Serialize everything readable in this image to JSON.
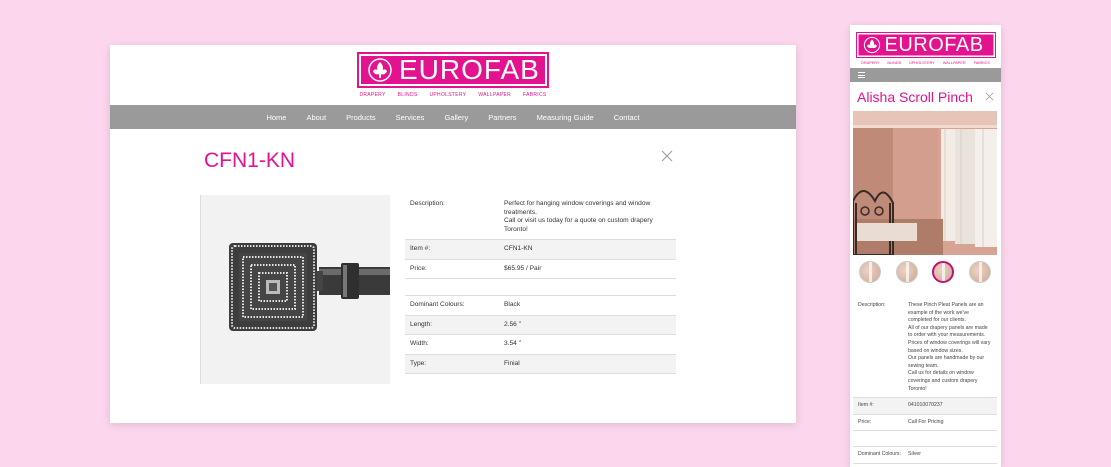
{
  "brand": {
    "name": "EUROFAB",
    "categories": [
      "DRAPERY",
      "BLINDS",
      "UPHOLSTERY",
      "WALLPAPER",
      "FABRICS"
    ],
    "accent": "#e3138f"
  },
  "nav": [
    "Home",
    "About",
    "Products",
    "Services",
    "Gallery",
    "Partners",
    "Measuring Guide",
    "Contact"
  ],
  "desktop": {
    "title": "CFN1-KN",
    "close_icon": "close-icon",
    "specs": [
      {
        "label": "Description:",
        "value": "Perfect for hanging window coverings and window treatments.\nCall or visit us today for a quote on custom drapery Toronto!"
      },
      {
        "label": "Item #:",
        "value": "CFN1-KN"
      },
      {
        "label": "Price:",
        "value": "$65.95 / Pair"
      }
    ],
    "specs2": [
      {
        "label": "Dominant Colours:",
        "value": "Black"
      },
      {
        "label": "Length:",
        "value": "2.56 \""
      },
      {
        "label": "Width:",
        "value": "3.54 \""
      },
      {
        "label": "Type:",
        "value": "Finial"
      }
    ]
  },
  "mobile": {
    "title": "Alisha Scroll Pinch",
    "specs": [
      {
        "label": "Description:",
        "value": "These Pinch Pleat Panels are an example of the work we've completed for our clients.\nAll of our drapery panels are made to order with your measurements.\nPrices of window coverings will vary based on window sizes.\nOur panels are handmade by our sewing team.\nCall us for details on window coverings and custom drapery Toronto!"
      },
      {
        "label": "Item #:",
        "value": "041010070237"
      },
      {
        "label": "Price:",
        "value": "Call For Pricing"
      }
    ],
    "specs2": [
      {
        "label": "Dominant Colours:",
        "value": "Silver"
      }
    ]
  }
}
